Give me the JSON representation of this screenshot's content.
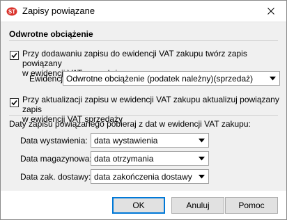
{
  "window": {
    "title": "Zapisy powiązane"
  },
  "section": {
    "title": "Odwrotne obciążenie"
  },
  "option_add": {
    "checked": true,
    "line1": "Przy dodawaniu zapisu do ewidencji VAT zakupu twórz zapis powiązany",
    "line2": "w ewidencji VAT sprzedaży"
  },
  "ewidencja": {
    "label": "Ewidencja:",
    "value": "Odwrotne obciążenie (podatek należny)(sprzedaż)"
  },
  "option_update": {
    "checked": true,
    "line1": "Przy aktualizacji zapisu w ewidencji VAT zakupu aktualizuj powiązany zapis",
    "line2": "w ewidencji VAT sprzedaży"
  },
  "dates": {
    "heading": "Daty zapisu powiązanego pobieraj z dat w ewidencji VAT zakupu:",
    "rows": [
      {
        "label": "Data wystawienia:",
        "value": "data wystawienia"
      },
      {
        "label": "Data magazynowa:",
        "value": "data otrzymania"
      },
      {
        "label": "Data zak. dostawy:",
        "value": "data zakończenia dostawy"
      }
    ]
  },
  "buttons": {
    "ok": "OK",
    "cancel": "Anuluj",
    "help": "Pomoc"
  },
  "colors": {
    "default_button_border": "#0078d7",
    "check_mark": "#000000",
    "app_icon": "#d9322b"
  }
}
